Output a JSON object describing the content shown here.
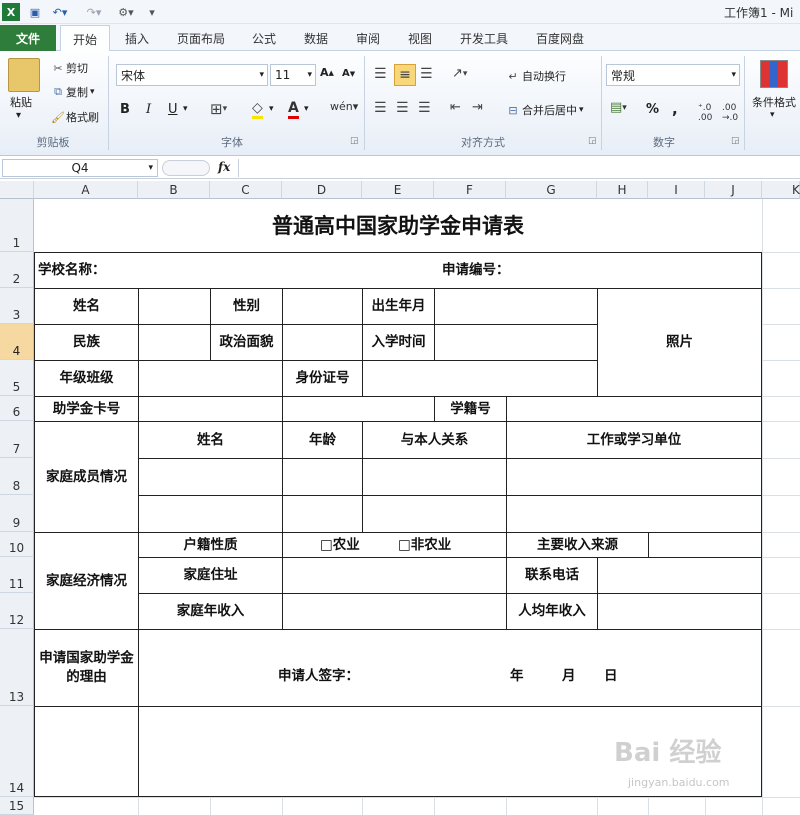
{
  "window": {
    "title": "工作簿1 - Mi"
  },
  "ribbon_tabs": [
    "文件",
    "开始",
    "插入",
    "页面布局",
    "公式",
    "数据",
    "审阅",
    "视图",
    "开发工具",
    "百度网盘"
  ],
  "clipboard": {
    "paste": "粘贴",
    "cut": "剪切",
    "copy": "复制",
    "format_painter": "格式刷",
    "group": "剪贴板"
  },
  "font": {
    "name": "宋体",
    "size": "11",
    "bold": "B",
    "italic": "I",
    "underline": "U",
    "group": "字体"
  },
  "alignment": {
    "wrap": "自动换行",
    "merge": "合并后居中",
    "group": "对齐方式"
  },
  "number": {
    "format": "常规",
    "percent": "%",
    "comma": ",",
    "group": "数字"
  },
  "styles": {
    "conditional": "条件格式"
  },
  "formula_bar": {
    "name_box": "Q4",
    "fx": "fx",
    "value": ""
  },
  "columns": [
    "A",
    "B",
    "C",
    "D",
    "E",
    "F",
    "G",
    "H",
    "I",
    "J",
    "K"
  ],
  "rows": [
    "1",
    "2",
    "3",
    "4",
    "5",
    "6",
    "7",
    "8",
    "9",
    "10",
    "11",
    "12",
    "13",
    "14",
    "15"
  ],
  "form": {
    "title": "普通高中国家助学金申请表",
    "school_name": "学校名称：",
    "app_no": "申请编号：",
    "name": "姓名",
    "gender": "性别",
    "birth": "出生年月",
    "photo": "照片",
    "ethnicity": "民族",
    "politics": "政治面貌",
    "enroll": "入学时间",
    "grade_class": "年级班级",
    "id_no": "身份证号",
    "card_no": "助学金卡号",
    "student_no": "学籍号",
    "family_members": "家庭成员情况",
    "fm_name": "姓名",
    "fm_age": "年龄",
    "fm_relation": "与本人关系",
    "fm_work": "工作或学习单位",
    "family_econ": "家庭经济情况",
    "hukou": "户籍性质",
    "agri": "□农业",
    "nonagri": "□非农业",
    "income_source": "主要收入来源",
    "address": "家庭住址",
    "phone": "联系电话",
    "annual_income": "家庭年收入",
    "per_capita": "人均年收入",
    "reason": "申请国家助学金的理由",
    "signature": "申请人签字：",
    "year": "年",
    "month": "月",
    "day": "日"
  },
  "watermark": {
    "text": "Bai 经验",
    "sub": "jingyan.baidu.com"
  }
}
